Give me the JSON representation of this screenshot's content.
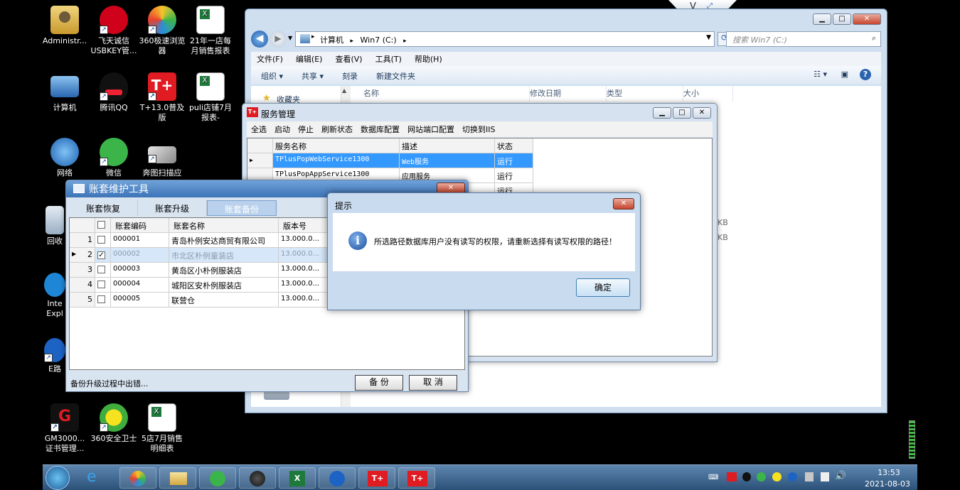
{
  "desktop": {
    "icons": [
      {
        "label": "Administr...",
        "icon": "user-folder-icon"
      },
      {
        "label": "飞天诚信\nUSBKEY管...",
        "icon": "citic-bank-icon"
      },
      {
        "label": "360极速浏览\n器",
        "icon": "360-browser-icon"
      },
      {
        "label": "21年一店每\n月销售报表",
        "icon": "excel-file-icon"
      },
      {
        "label": "计算机",
        "icon": "computer-icon"
      },
      {
        "label": "腾讯QQ",
        "icon": "qq-icon"
      },
      {
        "label": "T+13.0普及\n版",
        "icon": "tplus-icon"
      },
      {
        "label": "puli店铺7月\n报表-",
        "icon": "excel-file-icon"
      },
      {
        "label": "网络",
        "icon": "network-icon"
      },
      {
        "label": "微信",
        "icon": "wechat-icon"
      },
      {
        "label": "奔图扫描应",
        "icon": "scanner-icon"
      },
      {
        "label": "回收",
        "icon": "recycle-bin-icon"
      },
      {
        "label": "Inte\nExpl",
        "icon": "ie-icon"
      },
      {
        "label": "E路",
        "icon": "e-lu-icon"
      },
      {
        "label": "GM3000...\n证书管理...",
        "icon": "gm3000-icon"
      },
      {
        "label": "360安全卫士",
        "icon": "360-safe-icon"
      },
      {
        "label": "5店7月销售\n明细表",
        "icon": "excel-file-icon"
      }
    ]
  },
  "explorer": {
    "breadcrumb": [
      "计算机",
      "Win7 (C:)"
    ],
    "search_placeholder": "搜索 Win7 (C:)",
    "menu": [
      "文件(F)",
      "编辑(E)",
      "查看(V)",
      "工具(T)",
      "帮助(H)"
    ],
    "toolbar": [
      "组织 ▾",
      "共享 ▾",
      "刻录",
      "新建文件夹"
    ],
    "nav_favorites": "收藏夹",
    "columns": [
      "名称",
      "修改日期",
      "类型",
      "大小"
    ],
    "size_fragments": [
      "KB",
      "KB"
    ]
  },
  "service_manager": {
    "title": "服务管理",
    "toolbar": [
      "全选",
      "启动",
      "停止",
      "刷新状态",
      "数据库配置",
      "网站端口配置",
      "切换到IIS"
    ],
    "columns": [
      "服务名称",
      "描述",
      "状态"
    ],
    "rows": [
      {
        "name": "TPlusPopWebService1300",
        "desc": "Web服务",
        "status": "运行"
      },
      {
        "name": "TPlusPopAppService1300",
        "desc": "应用服务",
        "status": "运行"
      },
      {
        "name": "",
        "desc": "",
        "status": "运行"
      }
    ]
  },
  "account_tool": {
    "title": "账套维护工具",
    "tabs": [
      "账套恢复",
      "账套升级",
      "账套备份"
    ],
    "active_tab": 2,
    "columns": [
      "账套编码",
      "账套名称",
      "版本号"
    ],
    "rows": [
      {
        "num": "1",
        "code": "000001",
        "name": "青岛朴例安达商贸有限公司",
        "ver": "13.000.0...",
        "checked": false
      },
      {
        "num": "2",
        "code": "000002",
        "name": "市北区朴例童装店",
        "ver": "13.000.0...",
        "checked": true
      },
      {
        "num": "3",
        "code": "000003",
        "name": "黄岛区小朴例服装店",
        "ver": "13.000.0...",
        "checked": false
      },
      {
        "num": "4",
        "code": "000004",
        "name": "城阳区安朴例服装店",
        "ver": "13.000.0...",
        "checked": false
      },
      {
        "num": "5",
        "code": "000005",
        "name": "联营仓",
        "ver": "13.000.0...",
        "checked": false
      }
    ],
    "status": "备份升级过程中出错...",
    "backup_label": "备 份",
    "cancel_label": "取 消"
  },
  "dialog": {
    "title": "提示",
    "message": "所选路径数据库用户没有读写的权限，请重新选择有读写权限的路径！",
    "ok_label": "确定"
  },
  "taskbar": {
    "time": "13:53",
    "date": "2021-08-03"
  },
  "colors": {
    "selection": "#3399ff",
    "title_blue": "#4a80c2",
    "error_red": "#c7452f"
  }
}
